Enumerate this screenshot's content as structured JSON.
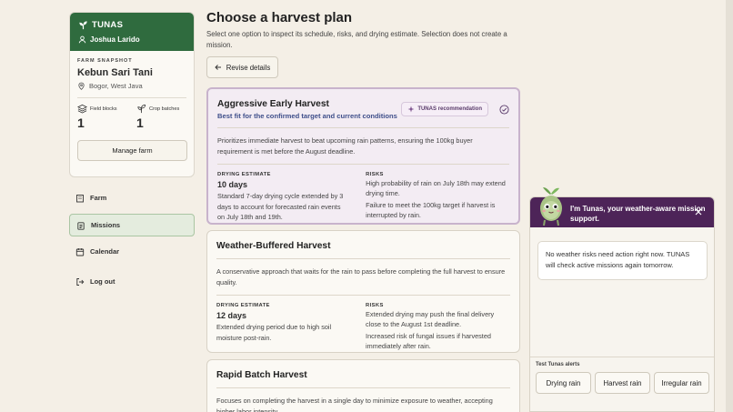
{
  "brand": {
    "name": "TUNAS"
  },
  "user": {
    "name": "Joshua Larido"
  },
  "farm": {
    "section_label": "FARM SNAPSHOT",
    "name": "Kebun Sari Tani",
    "location": "Bogor, West Java",
    "stats": [
      {
        "label": "Field blocks",
        "value": "1"
      },
      {
        "label": "Crop batches",
        "value": "1"
      }
    ],
    "manage_label": "Manage farm"
  },
  "nav": [
    {
      "label": "Farm",
      "icon": "building-icon"
    },
    {
      "label": "Missions",
      "icon": "clipboard-icon",
      "active": true
    },
    {
      "label": "Calendar",
      "icon": "calendar-icon"
    },
    {
      "label": "Log out",
      "icon": "logout-icon"
    }
  ],
  "header": {
    "title": "Choose a harvest plan",
    "subtitle": "Select one option to inspect its schedule, risks, and drying estimate. Selection does not create a mission.",
    "revise_label": "Revise details"
  },
  "plans": [
    {
      "title": "Aggressive Early Harvest",
      "subtitle": "Best fit for the confirmed target and current conditions",
      "badge": "TUNAS recommendation",
      "description": "Prioritizes immediate harvest to beat upcoming rain patterns, ensuring the 100kg buyer requirement is met before the August deadline.",
      "estimate_label": "DRYING ESTIMATE",
      "estimate_value": "10 days",
      "estimate_text": "Standard 7-day drying cycle extended by 3 days to account for forecasted rain events on July 18th and 19th.",
      "risks_label": "RISKS",
      "risks": [
        "High probability of rain on July 18th may extend drying time.",
        "Failure to meet the 100kg target if harvest is interrupted by rain."
      ]
    },
    {
      "title": "Weather-Buffered Harvest",
      "description": "A conservative approach that waits for the rain to pass before completing the full harvest to ensure quality.",
      "estimate_label": "DRYING ESTIMATE",
      "estimate_value": "12 days",
      "estimate_text": "Extended drying period due to high soil moisture post-rain.",
      "risks_label": "RISKS",
      "risks": [
        "Extended drying may push the final delivery close to the August 1st deadline.",
        "Increased risk of fungal issues if harvested immediately after rain."
      ]
    },
    {
      "title": "Rapid Batch Harvest",
      "description": "Focuses on completing the harvest in a single day to minimize exposure to weather, accepting higher labor intensity."
    }
  ],
  "chat": {
    "title": "I'm Tunas, your weather-aware mission support.",
    "message": "No weather risks need action right now. TUNAS will check active missions again tomorrow.",
    "test_label": "Test Tunas alerts",
    "buttons": [
      "Drying rain",
      "Harvest rain",
      "Irregular rain"
    ]
  }
}
